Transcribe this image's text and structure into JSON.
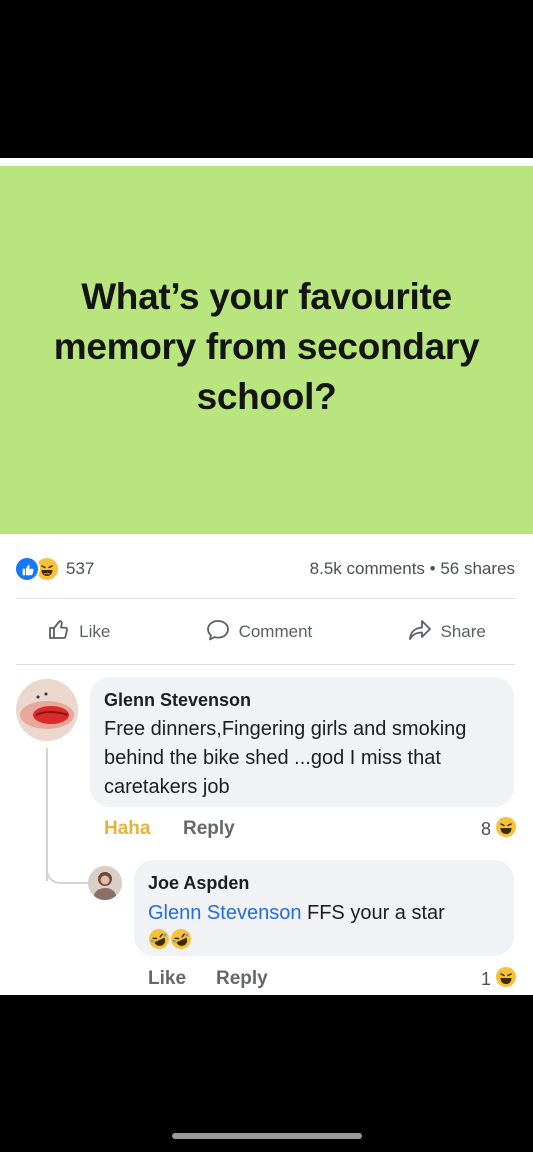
{
  "post": {
    "text": "What’s your favourite memory from secondary school?",
    "background_color": "#b8e57e"
  },
  "stats": {
    "reaction_icons": [
      "like-icon",
      "haha-icon"
    ],
    "reaction_count": "537",
    "comments_shares": "8.5k comments • 56 shares"
  },
  "actions": {
    "like": "Like",
    "comment": "Comment",
    "share": "Share"
  },
  "comments": [
    {
      "author": "Glenn Stevenson",
      "text": "Free dinners,Fingering girls and smoking behind the bike shed ...god I miss that caretakers job",
      "reacted_label": "Haha",
      "reply_label": "Reply",
      "reaction_count": "8",
      "reaction_icon": "haha-icon",
      "replies": [
        {
          "author": "Joe Aspden",
          "mention": "Glenn Stevenson",
          "text": " FFS your a star",
          "emojis": [
            "rolling-laughing-icon",
            "rolling-laughing-icon"
          ],
          "like_label": "Like",
          "reply_label": "Reply",
          "reaction_count": "1",
          "reaction_icon": "haha-icon"
        }
      ]
    }
  ],
  "colors": {
    "link_blue": "#216fdb",
    "haha_yellow": "#e8b23c",
    "bubble_grey": "#f0f2f5"
  }
}
